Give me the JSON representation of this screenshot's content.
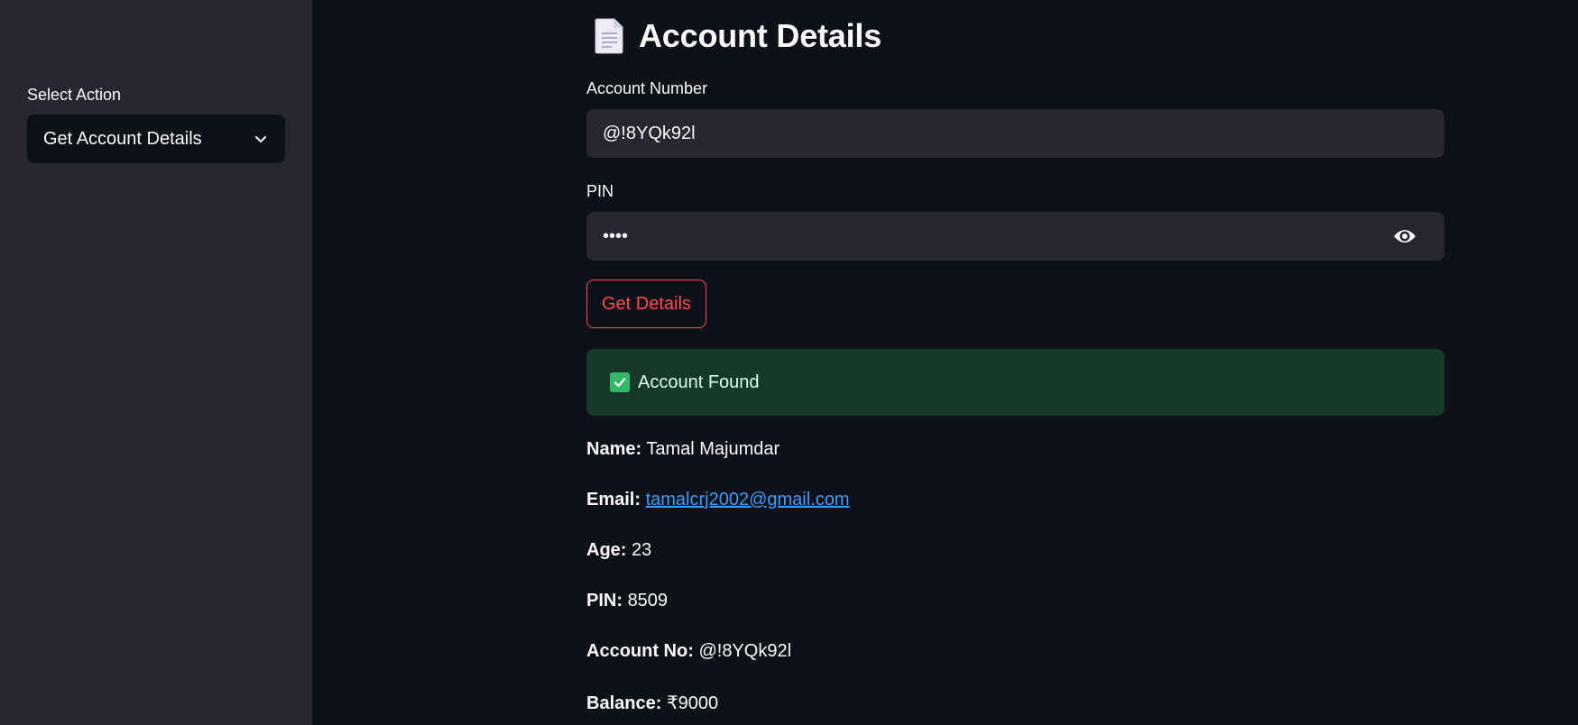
{
  "sidebar": {
    "select_label": "Select Action",
    "select_value": "Get Account Details"
  },
  "main": {
    "title": "Account Details",
    "title_icon": "document-icon",
    "account_number": {
      "label": "Account Number",
      "value": "@!8YQk92l"
    },
    "pin": {
      "label": "PIN",
      "value": "••••"
    },
    "button_label": "Get Details",
    "alert_text": "Account Found",
    "details": {
      "name_label": "Name:",
      "name_value": "Tamal Majumdar",
      "email_label": "Email:",
      "email_value": "tamalcrj2002@gmail.com",
      "age_label": "Age:",
      "age_value": "23",
      "pin_label": "PIN:",
      "pin_value": "8509",
      "account_label": "Account No:",
      "account_value": "@!8YQk92l",
      "balance_label": "Balance:",
      "balance_value": "₹9000"
    }
  },
  "colors": {
    "background": "#0e1117",
    "sidebar": "#262730",
    "input": "#262730",
    "primary": "#ff4b4b",
    "success_bg": "#173928",
    "link": "#3b9cff"
  }
}
